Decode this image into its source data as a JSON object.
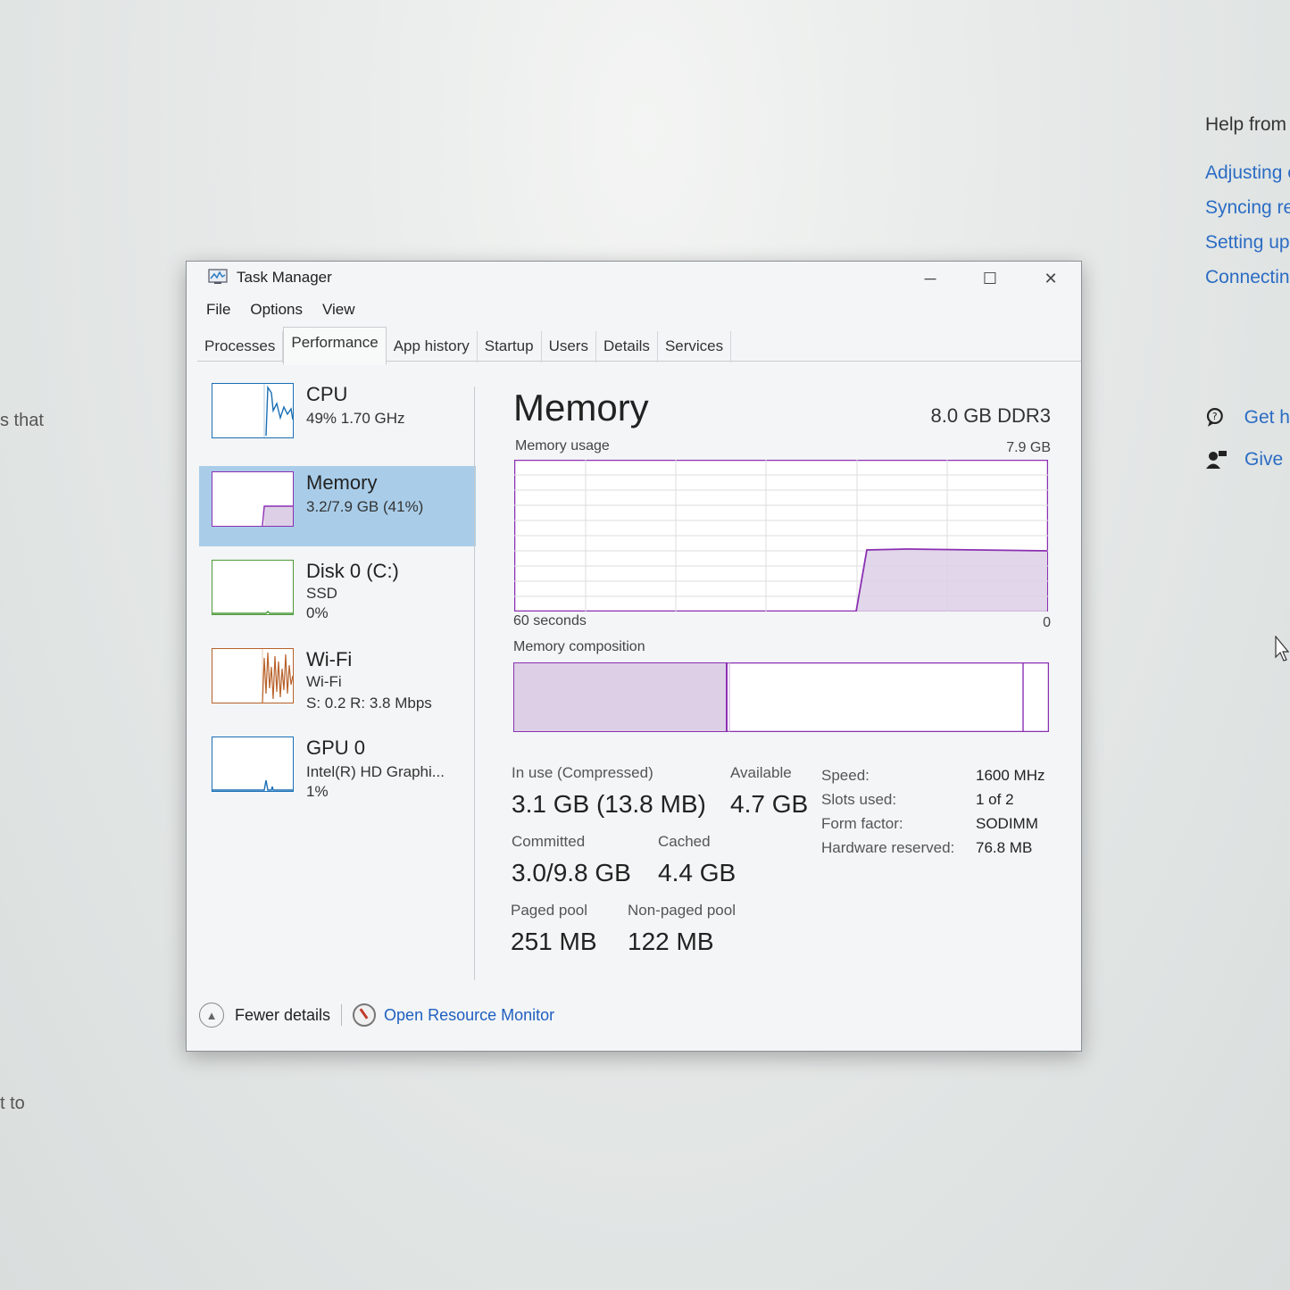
{
  "background": {
    "left_texts": [
      "s that",
      "t to"
    ],
    "help": {
      "title": "Help from",
      "links": [
        "Adjusting easily",
        "Syncing re playback",
        "Setting up",
        "Connectin"
      ],
      "actions": [
        {
          "icon": "chat-help-icon",
          "label": "Get h"
        },
        {
          "icon": "feedback-icon",
          "label": "Give"
        }
      ]
    }
  },
  "window": {
    "title": "Task Manager",
    "controls": {
      "minimize": "─",
      "maximize": "☐",
      "close": "✕"
    },
    "menu": [
      "File",
      "Options",
      "View"
    ],
    "tabs": [
      "Processes",
      "Performance",
      "App history",
      "Startup",
      "Users",
      "Details",
      "Services"
    ],
    "active_tab": "Performance"
  },
  "sidebar": {
    "items": [
      {
        "name": "CPU",
        "sub1": "49%  1.70 GHz",
        "sub2": "",
        "color": "#1a6fb5"
      },
      {
        "name": "Memory",
        "sub1": "3.2/7.9 GB (41%)",
        "sub2": "",
        "color": "#8b2fb3",
        "selected": true
      },
      {
        "name": "Disk 0 (C:)",
        "sub1": "SSD",
        "sub2": "0%",
        "color": "#4d9a3a"
      },
      {
        "name": "Wi-Fi",
        "sub1": "Wi-Fi",
        "sub2": "S: 0.2  R: 3.8 Mbps",
        "color": "#b8612a"
      },
      {
        "name": "GPU 0",
        "sub1": "Intel(R) HD Graphi...",
        "sub2": "1%",
        "color": "#1a6fb5"
      }
    ]
  },
  "main": {
    "title": "Memory",
    "memory_type": "8.0 GB DDR3",
    "usage_label": "Memory usage",
    "usage_max": "7.9 GB",
    "time_label": "60 seconds",
    "time_end": "0",
    "composition_label": "Memory composition",
    "in_use_label": "In use (Compressed)",
    "in_use_value": "3.1 GB (13.8 MB)",
    "available_label": "Available",
    "available_value": "4.7 GB",
    "committed_label": "Committed",
    "committed_value": "3.0/9.8 GB",
    "cached_label": "Cached",
    "cached_value": "4.4 GB",
    "paged_label": "Paged pool",
    "paged_value": "251 MB",
    "nonpaged_label": "Non-paged pool",
    "nonpaged_value": "122 MB",
    "specs": [
      {
        "label": "Speed:",
        "value": "1600 MHz"
      },
      {
        "label": "Slots used:",
        "value": "1 of 2"
      },
      {
        "label": "Form factor:",
        "value": "SODIMM"
      },
      {
        "label": "Hardware reserved:",
        "value": "76.8 MB"
      }
    ]
  },
  "footer": {
    "fewer_details": "Fewer details",
    "resource_monitor": "Open Resource Monitor"
  },
  "colors": {
    "memory_accent": "#8b2fb3",
    "memory_fill": "#ddd0e6",
    "selected_bg": "#a9cde9",
    "link": "#1f5fbf"
  }
}
